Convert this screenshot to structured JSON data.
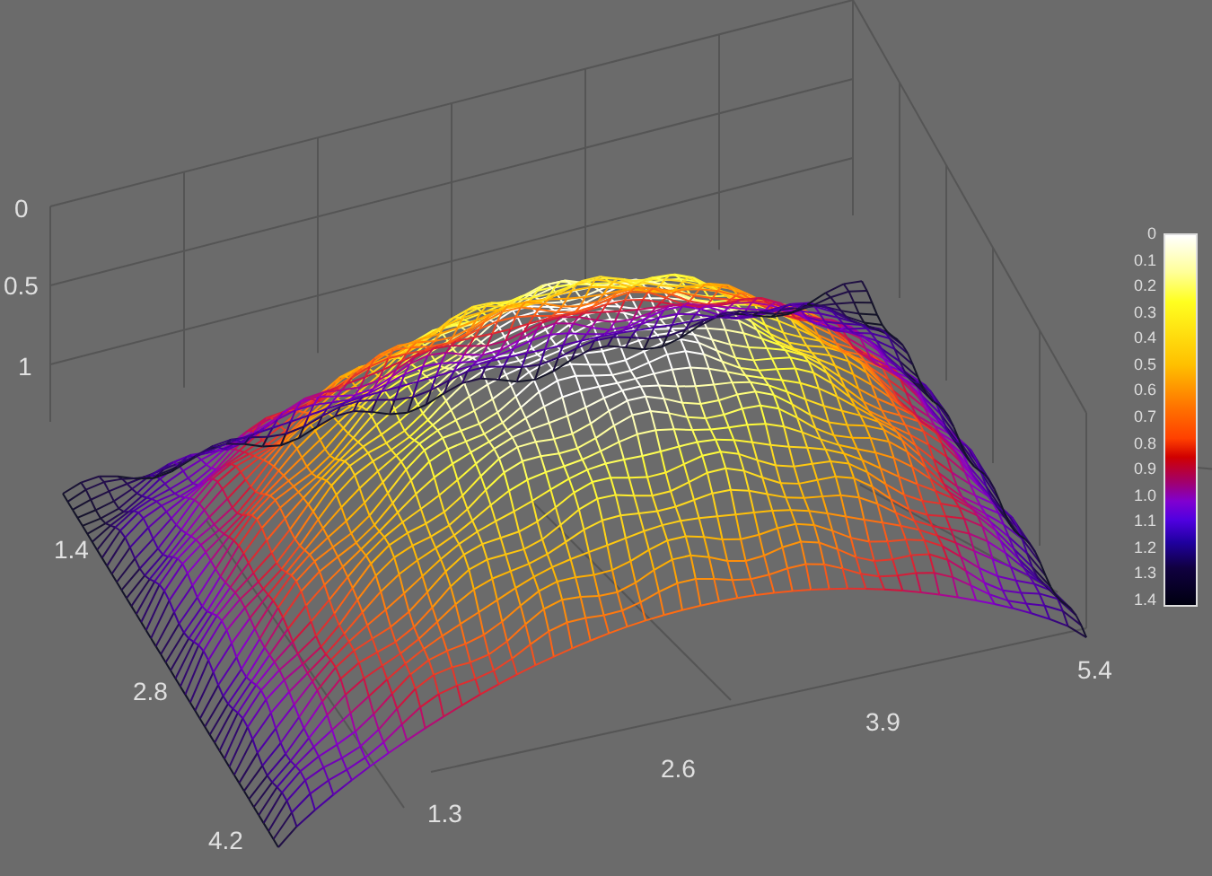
{
  "plot": {
    "z_ticks": [
      "0",
      "0.5",
      "1"
    ],
    "y_ticks": [
      "1.4",
      "2.8",
      "4.2"
    ],
    "x_ticks": [
      "1.3",
      "2.6",
      "3.9",
      "5.4"
    ]
  },
  "colorbar": {
    "ticks": [
      "0",
      "0.1",
      "0.2",
      "0.3",
      "0.4",
      "0.5",
      "0.6",
      "0.7",
      "0.8",
      "0.9",
      "1.0",
      "1.1",
      "1.2",
      "1.3",
      "1.4"
    ]
  }
}
